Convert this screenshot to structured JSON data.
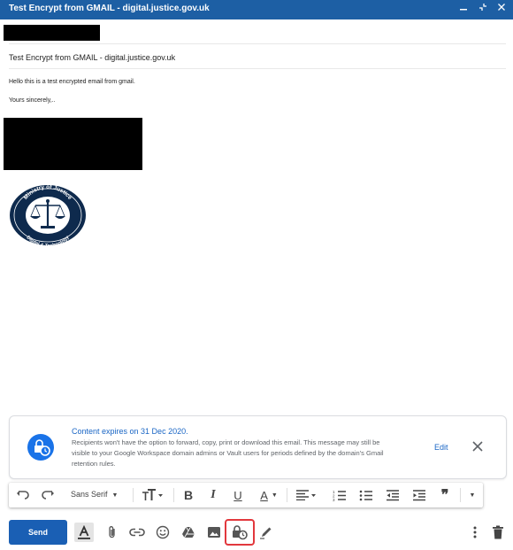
{
  "window": {
    "title": "Test Encrypt from GMAIL - digital.justice.gov.uk",
    "controls": [
      "minimize-icon",
      "exit-fullscreen-icon",
      "close-icon"
    ]
  },
  "compose": {
    "subject": "Test Encrypt from GMAIL - digital.justice.gov.uk",
    "body_lines": [
      "Hello this is a test encrypted email from gmail.",
      "Yours sincerely,.."
    ],
    "logo_text": [
      "Ministry of Justice",
      "Digital & Technology"
    ]
  },
  "confidential_banner": {
    "title": "Content expires on 31 Dec 2020.",
    "description": "Recipients won't have the option to forward, copy, print or download this email. This message may still be visible to your Google Workspace domain admins or Vault users for periods defined by the domain's Gmail retention rules.",
    "edit_label": "Edit"
  },
  "formatting": {
    "font": "Sans Serif",
    "icons": [
      "undo-icon",
      "redo-icon",
      "font-dropdown",
      "text-size-icon",
      "bold-icon",
      "italic-icon",
      "underline-icon",
      "text-color-icon",
      "align-icon",
      "numbered-list-icon",
      "bulleted-list-icon",
      "indent-less-icon",
      "indent-more-icon",
      "quote-icon",
      "more-formatting-icon"
    ],
    "labels": {
      "bold": "B",
      "italic": "I",
      "underline": "U",
      "text_color": "A",
      "quote": "❞"
    }
  },
  "toolbar": {
    "send_label": "Send",
    "icons": [
      "formatting-options-icon",
      "attach-icon",
      "link-icon",
      "emoji-icon",
      "drive-icon",
      "photo-icon",
      "confidential-mode-icon",
      "signature-icon",
      "more-options-icon",
      "discard-icon"
    ]
  },
  "colors": {
    "titlebar": "#1d5fa4",
    "send_button": "#1a5fb4",
    "accent_blue": "#1a73e8",
    "highlight_red": "#e2383d",
    "logo_navy": "#0e2a4d"
  }
}
